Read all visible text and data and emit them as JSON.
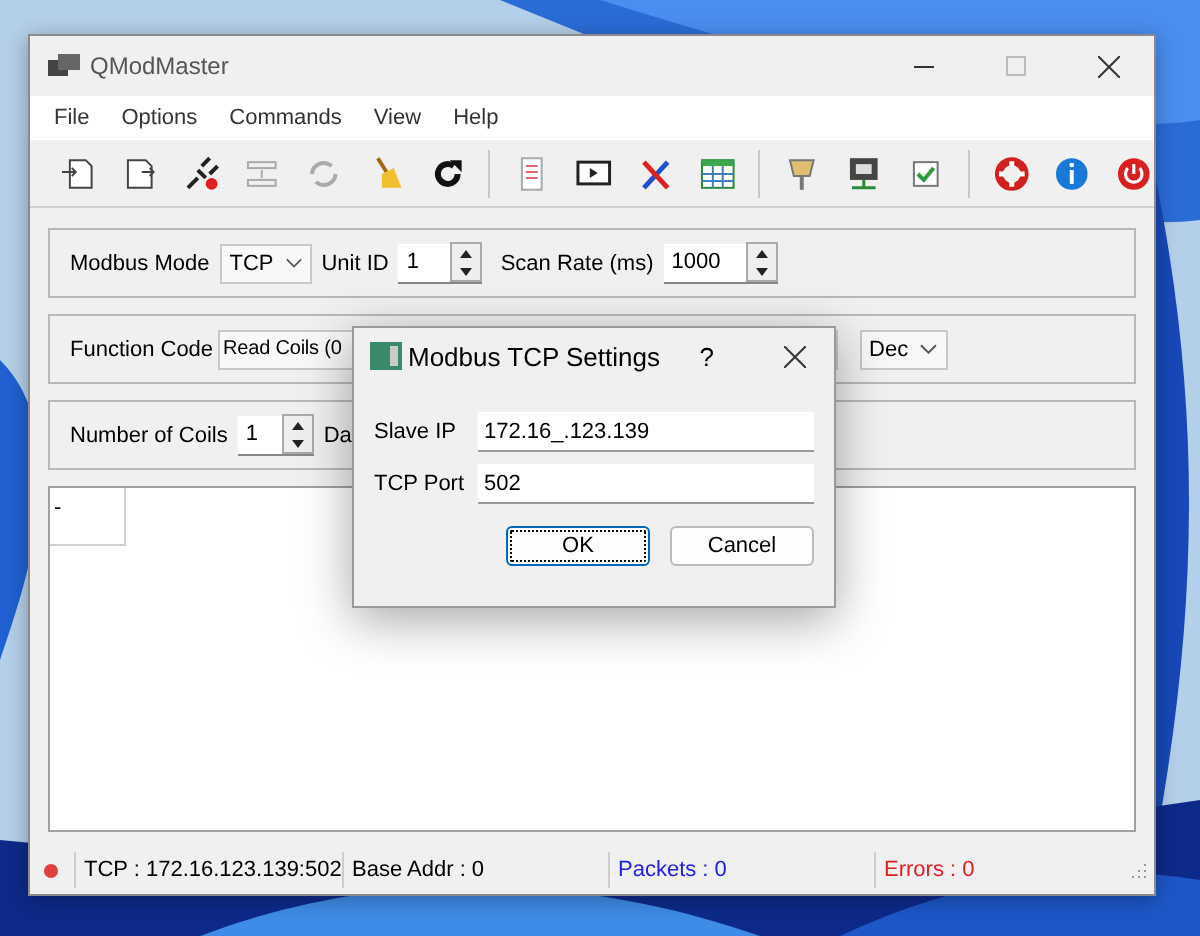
{
  "window": {
    "title": "QModMaster"
  },
  "menu": [
    "File",
    "Options",
    "Commands",
    "View",
    "Help"
  ],
  "settings": {
    "mode_label": "Modbus Mode",
    "mode": "TCP",
    "unit_label": "Unit ID",
    "unit": "1",
    "scan_label": "Scan Rate (ms)",
    "scan": "1000"
  },
  "function": {
    "label": "Function Code",
    "value": "Read Coils (0",
    "format": "Dec"
  },
  "coils": {
    "label": "Number of Coils",
    "value": "1",
    "next_label": "Da"
  },
  "results": {
    "cell": "-"
  },
  "status_bar": {
    "connected": false,
    "connection": "TCP : 172.16.123.139:502",
    "base": "Base Addr : 0",
    "packets": "Packets : 0",
    "errors": "Errors : 0"
  },
  "dialog": {
    "title": "Modbus TCP Settings",
    "help": "?",
    "fields": [
      {
        "label": "Slave IP",
        "value": "172.16_.123.139"
      },
      {
        "label": "TCP Port",
        "value": "502"
      }
    ],
    "buttons": [
      {
        "label": "OK",
        "focused": true
      },
      {
        "label": "Cancel",
        "focused": false
      }
    ]
  }
}
